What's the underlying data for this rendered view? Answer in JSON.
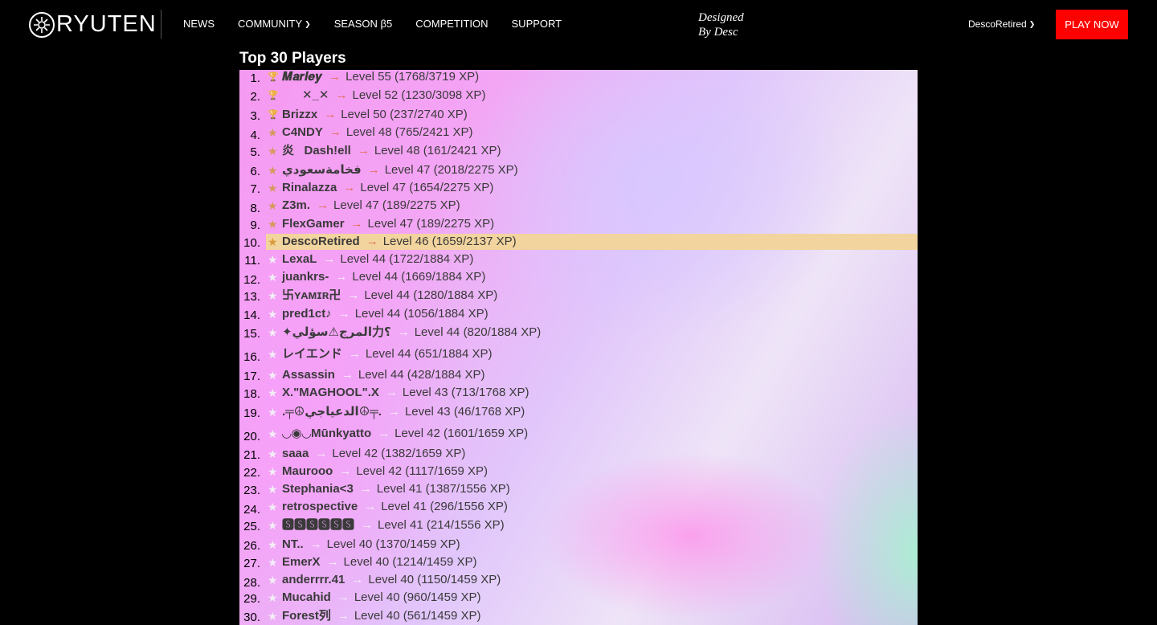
{
  "nav": {
    "logo_text": "RYUTEN",
    "links": [
      "NEWS",
      "COMMUNITY",
      "SEASON β5",
      "COMPETITION",
      "SUPPORT"
    ],
    "designed_line1": "Designed",
    "designed_line2": "By Desc",
    "user": "DescoRetired",
    "play": "PLAY NOW",
    "play_color": "#ff0000"
  },
  "leaderboard": {
    "title": "Top 30 Players",
    "highlight_color": "#f2d49e",
    "players": [
      {
        "rank": "1.",
        "icon": "trophy-gold-icon",
        "name": "𝑴𝒂𝒓𝒍𝒆𝒚",
        "level": "Level 55 (1768/3719 XP)"
      },
      {
        "rank": "2.",
        "icon": "trophy-silver-icon",
        "name": "      ✕_✕",
        "level": "Level 52 (1230/3098 XP)"
      },
      {
        "rank": "3.",
        "icon": "trophy-bronze-icon",
        "name": "Brizzx",
        "level": "Level 50 (237/2740 XP)"
      },
      {
        "rank": "4.",
        "icon": "star-icon",
        "name": "C4NDY",
        "level": "Level 48 (765/2421 XP)"
      },
      {
        "rank": "5.",
        "icon": "star-icon",
        "name": "炎   Dash!ell",
        "level": "Level 48 (161/2421 XP)"
      },
      {
        "rank": "6.",
        "icon": "star-icon",
        "name": "فخامةسعودي",
        "level": "Level 47 (2018/2275 XP)"
      },
      {
        "rank": "7.",
        "icon": "star-icon",
        "name": "Rinalazza",
        "level": "Level 47 (1654/2275 XP)"
      },
      {
        "rank": "8.",
        "icon": "star-icon",
        "name": "Z3m.",
        "level": "Level 47 (189/2275 XP)"
      },
      {
        "rank": "9.",
        "icon": "star-icon",
        "name": "FlexGamer",
        "level": "Level 47 (189/2275 XP)"
      },
      {
        "rank": "10.",
        "icon": "star-icon",
        "name": "DescoRetired",
        "level": "Level 46 (1659/2137 XP)",
        "highlight": true
      },
      {
        "rank": "11.",
        "icon": "star-icon",
        "name": "LexaL",
        "level": "Level 44 (1722/1884 XP)"
      },
      {
        "rank": "12.",
        "icon": "star-icon",
        "name": "juankrs-",
        "level": "Level 44 (1669/1884 XP)"
      },
      {
        "rank": "13.",
        "icon": "star-icon",
        "name": "卐ʏᴀᴍɪʀ卍",
        "level": "Level 44 (1280/1884 XP)"
      },
      {
        "rank": "14.",
        "icon": "star-icon",
        "name": "pred1ct♪",
        "level": "Level 44 (1056/1884 XP)"
      },
      {
        "rank": "15.",
        "icon": "star-icon",
        "name": "✦المرج⚠سؤلي力؟",
        "level": "Level 44 (820/1884 XP)"
      },
      {
        "rank": "16.",
        "icon": "star-icon",
        "name": "レイエンド",
        "level": "Level 44 (651/1884 XP)"
      },
      {
        "rank": "17.",
        "icon": "star-icon",
        "name": "Assassin",
        "level": "Level 44 (428/1884 XP)"
      },
      {
        "rank": "18.",
        "icon": "star-icon",
        "name": "X.\"MAGHOOL\".X",
        "level": "Level 43 (713/1768 XP)"
      },
      {
        "rank": "19.",
        "icon": "star-icon",
        "name": ".╤☮الدعياجي☮╤.",
        "level": "Level 43 (46/1768 XP)"
      },
      {
        "rank": "20.",
        "icon": "star-icon",
        "name": "◡◉◡Mūnkyatto",
        "level": "Level 42 (1601/1659 XP)"
      },
      {
        "rank": "21.",
        "icon": "star-icon",
        "name": "saaa",
        "level": "Level 42 (1382/1659 XP)"
      },
      {
        "rank": "22.",
        "icon": "star-icon",
        "name": "Maurooo",
        "level": "Level 42 (1117/1659 XP)"
      },
      {
        "rank": "23.",
        "icon": "star-icon",
        "name": "Stephania<3",
        "level": "Level 41 (1387/1556 XP)"
      },
      {
        "rank": "24.",
        "icon": "star-icon",
        "name": "retrospective",
        "level": "Level 41 (296/1556 XP)"
      },
      {
        "rank": "25.",
        "icon": "star-icon",
        "name": "🆂🆂🆂🆂🆂🆂",
        "level": "Level 41 (214/1556 XP)"
      },
      {
        "rank": "26.",
        "icon": "star-icon",
        "name": "NT..",
        "level": "Level 40 (1370/1459 XP)"
      },
      {
        "rank": "27.",
        "icon": "star-icon",
        "name": "EmerX",
        "level": "Level 40 (1214/1459 XP)"
      },
      {
        "rank": "28.",
        "icon": "star-icon",
        "name": "anderrrr.41",
        "level": "Level 40 (1150/1459 XP)"
      },
      {
        "rank": "29.",
        "icon": "star-icon",
        "name": "Mucahid",
        "level": "Level 40 (960/1459 XP)"
      },
      {
        "rank": "30.",
        "icon": "star-icon",
        "name": "Forest列",
        "level": "Level 40 (561/1459 XP)"
      }
    ]
  }
}
